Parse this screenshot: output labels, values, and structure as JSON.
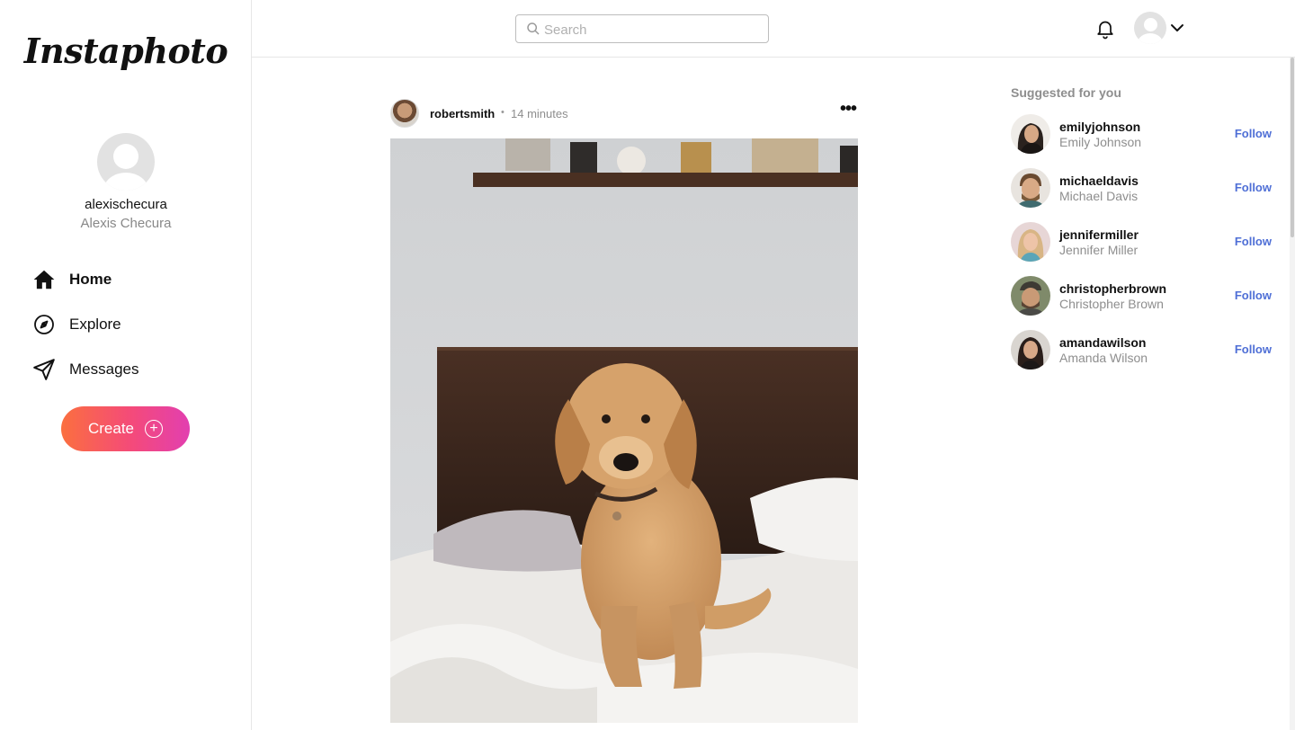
{
  "app": {
    "logo": "Instaphoto"
  },
  "profile": {
    "username": "alexischecura",
    "fullname": "Alexis Checura"
  },
  "nav": {
    "items": [
      {
        "label": "Home",
        "icon": "home-icon"
      },
      {
        "label": "Explore",
        "icon": "compass-icon"
      },
      {
        "label": "Messages",
        "icon": "send-icon"
      }
    ],
    "create_label": "Create"
  },
  "search": {
    "placeholder": "Search",
    "value": ""
  },
  "post": {
    "username": "robertsmith",
    "separator": "•",
    "time": "14 minutes",
    "more": "•••",
    "image_alt": "Golden retriever puppy sitting on an unmade bed"
  },
  "suggestions": {
    "title": "Suggested for you",
    "follow_label": "Follow",
    "items": [
      {
        "username": "emilyjohnson",
        "fullname": "Emily Johnson",
        "avatar_color": "#6b5a4d"
      },
      {
        "username": "michaeldavis",
        "fullname": "Michael Davis",
        "avatar_color": "#8a6a4a"
      },
      {
        "username": "jennifermiller",
        "fullname": "Jennifer Miller",
        "avatar_color": "#c9a27a"
      },
      {
        "username": "christopherbrown",
        "fullname": "Christopher Brown",
        "avatar_color": "#5f5a4a"
      },
      {
        "username": "amandawilson",
        "fullname": "Amanda Wilson",
        "avatar_color": "#3e3430"
      }
    ]
  },
  "colors": {
    "accent_follow": "#4f6fd6",
    "create_gradient_start": "#fb6f3f",
    "create_gradient_end": "#e23fb0"
  }
}
